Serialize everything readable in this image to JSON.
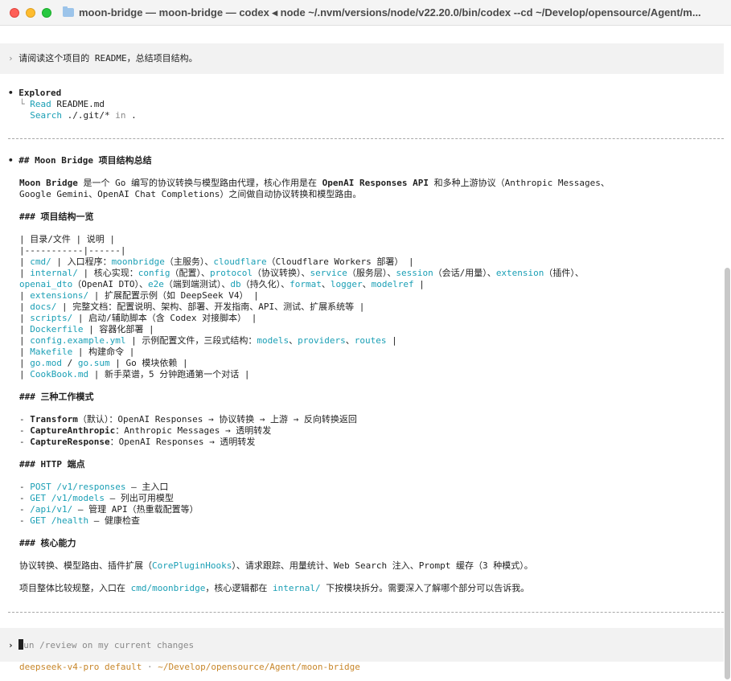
{
  "window": {
    "title": "moon-bridge — moon-bridge — codex ◂ node ~/.nvm/versions/node/v22.20.0/bin/codex --cd ~/Develop/opensource/Agent/m..."
  },
  "prompt": {
    "marker": "›",
    "text": "请阅读这个项目的 README，总结项目结构。"
  },
  "explored": {
    "bullet": "•",
    "heading": "Explored",
    "tree_glyph": "└",
    "read_verb": "Read",
    "read_target": "README.md",
    "search_verb": "Search",
    "search_target": "./.git/*",
    "search_in": "in",
    "search_dir": "."
  },
  "answer": {
    "bullet": "•",
    "h2": "## Moon Bridge 项目结构总结",
    "intro": {
      "name": "Moon Bridge",
      "t1": " 是一个 Go 编写的协议转换与模型路由代理，核心作用是在 ",
      "api": "OpenAI Responses API",
      "t2": " 和多种上游协议（Anthropic Messages、",
      "line2": "Google Gemini、OpenAI Chat Completions）之间做自动协议转换和模型路由。"
    },
    "h3_structure": "### 项目结构一览",
    "table_header": "| 目录/文件 | 说明 |",
    "table_sep": "|-----------|------|",
    "rows": {
      "cmd": {
        "pre": "| ",
        "path": "cmd/",
        "a": " | 入口程序：",
        "k1": "moonbridge",
        "b": "（主服务）、",
        "k2": "cloudflare",
        "c": "（Cloudflare Workers 部署） |"
      },
      "internal": {
        "pre": "| ",
        "path": "internal/",
        "a": " | 核心实现：",
        "k1": "config",
        "b": "（配置）、",
        "k2": "protocol",
        "c": "（协议转换）、",
        "k3": "service",
        "d": "（服务层）、",
        "k4": "session",
        "e": "（会话/用量）、",
        "k5": "extension",
        "f": "（插件）、",
        "k6": "openai_dto",
        "g": "（OpenAI DTO）、",
        "k7": "e2e",
        "h": "（端到端测试）、",
        "k8": "db",
        "i": "（持久化）、",
        "k9": "format",
        "j": "、",
        "k10": "logger",
        "k": "、",
        "k11": "modelref",
        "l": " |"
      },
      "extensions": {
        "pre": "| ",
        "path": "extensions/",
        "a": " | 扩展配置示例（如 DeepSeek V4） |"
      },
      "docs": {
        "pre": "| ",
        "path": "docs/",
        "a": " | 完整文档：配置说明、架构、部署、开发指南、API、测试、扩展系统等 |"
      },
      "scripts": {
        "pre": "| ",
        "path": "scripts/",
        "a": " | 启动/辅助脚本（含 Codex 对接脚本） |"
      },
      "dockerfile": {
        "pre": "| ",
        "path": "Dockerfile",
        "a": " | 容器化部署 |"
      },
      "config": {
        "pre": "| ",
        "path": "config.example.yml",
        "a": " | 示例配置文件，三段式结构：",
        "k1": "models",
        "b": "、",
        "k2": "providers",
        "c": "、",
        "k3": "routes",
        "d": " |"
      },
      "makefile": {
        "pre": "| ",
        "path": "Makefile",
        "a": " | 构建命令 |"
      },
      "gomod": {
        "pre": "| ",
        "path": "go.mod",
        "a": " / ",
        "path2": "go.sum",
        "b": " | Go 模块依赖 |"
      },
      "cookbook": {
        "pre": "| ",
        "path": "CookBook.md",
        "a": " | 新手菜谱，5 分钟跑通第一个对话 |"
      }
    },
    "h3_modes": "### 三种工作模式",
    "modes": [
      {
        "dash": "- ",
        "name": "Transform",
        "desc": "（默认）：OpenAI Responses → 协议转换 → 上游 → 反向转换返回"
      },
      {
        "dash": "- ",
        "name": "CaptureAnthropic",
        "desc": "：Anthropic Messages → 透明转发"
      },
      {
        "dash": "- ",
        "name": "CaptureResponse",
        "desc": "：OpenAI Responses → 透明转发"
      }
    ],
    "h3_http": "### HTTP 端点",
    "endpoints": [
      {
        "dash": "- ",
        "path": "POST /v1/responses",
        "desc": " — 主入口"
      },
      {
        "dash": "- ",
        "path": "GET /v1/models",
        "desc": " — 列出可用模型"
      },
      {
        "dash": "- ",
        "path": "/api/v1/",
        "desc": " — 管理 API（热重载配置等）"
      },
      {
        "dash": "- ",
        "path": "GET /health",
        "desc": " — 健康检查"
      }
    ],
    "h3_core": "### 核心能力",
    "core": {
      "a": "协议转换、模型路由、插件扩展（",
      "k": "CorePluginHooks",
      "b": "）、请求跟踪、用量统计、Web Search 注入、Prompt 缓存（3 种模式）。"
    },
    "summary": {
      "a": "项目整体比较规整，入口在 ",
      "k1": "cmd/moonbridge",
      "b": "，核心逻辑都在 ",
      "k2": "internal/",
      "c": " 下按模块拆分。需要深入了解哪个部分可以告诉我。"
    }
  },
  "input": {
    "marker": "›",
    "placeholder": "un /review on my current changes"
  },
  "status": {
    "model": "deepseek-v4-pro default",
    "sep": " · ",
    "path": "~/Develop/opensource/Agent/moon-bridge"
  },
  "colors": {
    "accent_cyan": "#1a9fb5",
    "model_orange": "#c8872b",
    "muted_gray": "#8a8a8a"
  }
}
